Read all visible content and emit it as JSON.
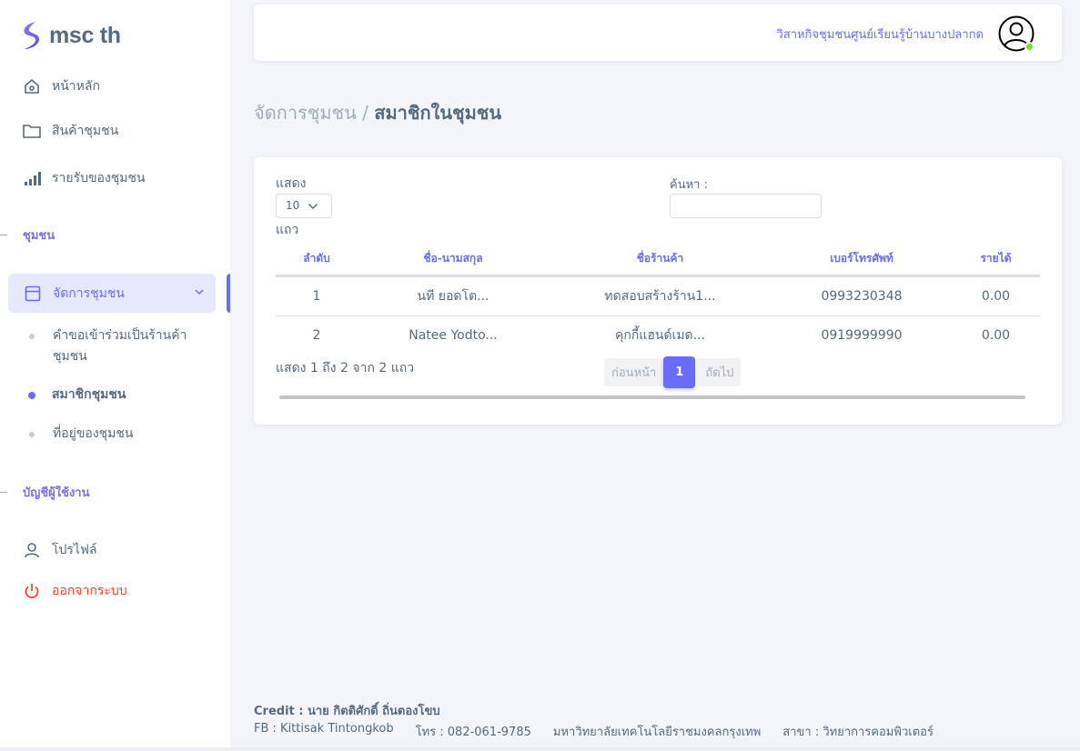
{
  "app": {
    "logo_text": "msc th"
  },
  "sidebar": {
    "items": [
      {
        "label": "หน้าหลัก",
        "icon": "home-icon"
      },
      {
        "label": "สินค้าชุมชน",
        "icon": "folder-icon"
      },
      {
        "label": "รายรับของชุมชน",
        "icon": "bar-chart-icon"
      }
    ],
    "section_community": "ชุมชน",
    "manage": {
      "label": "จัดการชุมชน",
      "icon": "layout-icon"
    },
    "sub_items": [
      {
        "label": "คำขอเข้าร่วมเป็นร้านค้าชุมชน"
      },
      {
        "label": "สมาชิกชุมชน"
      },
      {
        "label": "ที่อยู่ของชุมชน"
      }
    ],
    "section_account": "บัญชีผู้ใช้งาน",
    "profile": {
      "label": "โปรไฟล์",
      "icon": "user-icon"
    },
    "logout": {
      "label": "ออกจากระบบ",
      "icon": "power-icon"
    }
  },
  "navbar": {
    "org_name": "วิสาหกิจชุมชนศูนย์เรียนรู้บ้านบางปลากด"
  },
  "breadcrumb": {
    "parent": "จัดการชุมชน /",
    "current": "สมาชิกในชุมชน"
  },
  "table_controls": {
    "show_label": "แสดง",
    "page_size": "10",
    "rows_label": "แถว",
    "search_label": "ค้นหา :",
    "search_value": ""
  },
  "table": {
    "headers": [
      "ลำดับ",
      "ชื่อ-นามสกุล",
      "ชื่อร้านค้า",
      "เบอร์โทรศัพท์",
      "รายได้"
    ],
    "rows": [
      [
        "1",
        "นที ยอดโต...",
        "ทดสอบสร้างร้าน1...",
        "0993230348",
        "0.00"
      ],
      [
        "2",
        "Natee Yodto...",
        "คุกกี้แฮนด์เมด...",
        "0919999990",
        "0.00"
      ]
    ]
  },
  "pagination": {
    "info": "แสดง 1 ถึง 2 จาก 2 แถว",
    "prev": "ก่อนหน้า",
    "current_page": "1",
    "next": "ถัดไป"
  },
  "footer": {
    "credit": "Credit : นาย กิตติศักดิ์ ถิ่นตองโขบ",
    "fb": "FB : Kittisak Tintongkob",
    "phone": "โทร : 082-061-9785",
    "university": "มหาวิทยาลัยเทคโนโลยีราชมงคลกรุงเทพ",
    "branch": "สาขา : วิทยาการคอมพิวเตอร์"
  },
  "colors": {
    "accent": "#696cff",
    "active_bg": "#e7e7ff",
    "logout": "#ff3e1d",
    "online": "#71dd37",
    "text": "#566a7f",
    "background": "#f4f5fa"
  }
}
